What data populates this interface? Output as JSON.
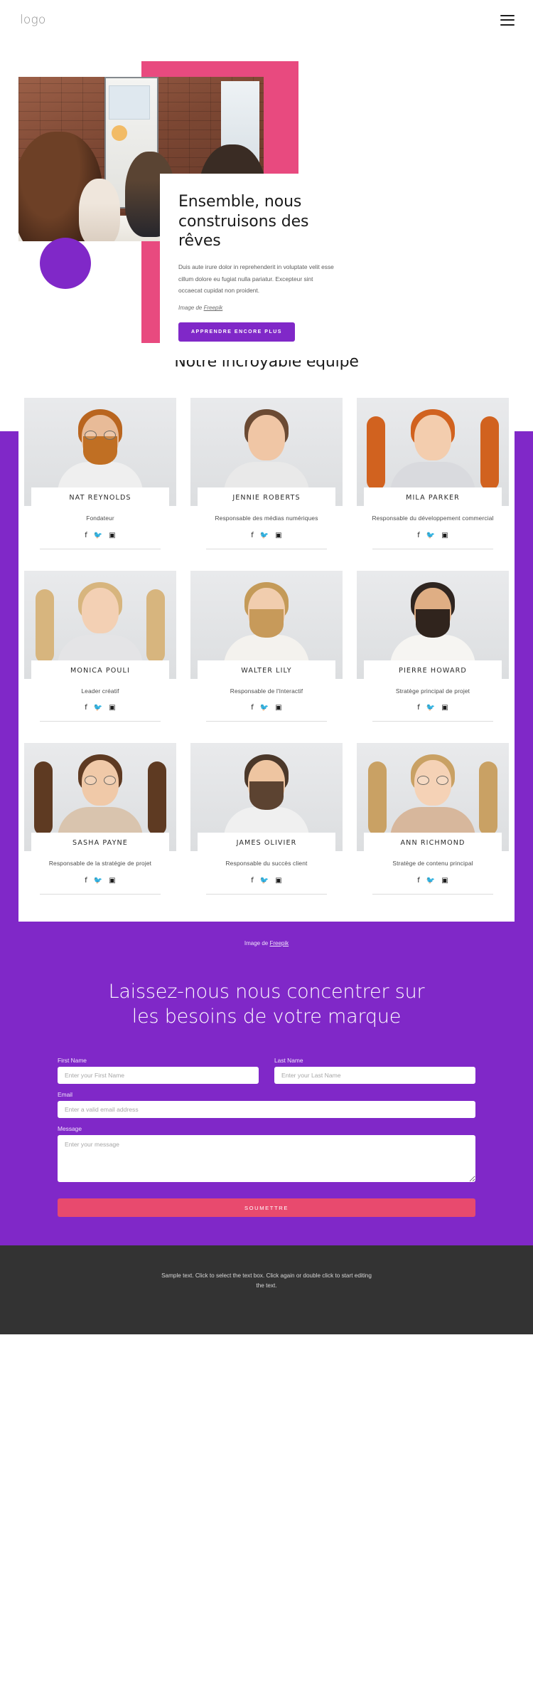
{
  "header": {
    "logo": "logo",
    "menu_icon": "hamburger-menu-icon"
  },
  "hero": {
    "title": "Ensemble, nous construisons des rêves",
    "description": "Duis aute irure dolor in reprehenderit in voluptate velit esse cillum dolore eu fugiat nulla pariatur. Excepteur sint occaecat cupidat non proident.",
    "credit_prefix": "Image de ",
    "credit_link": "Freepik",
    "cta_label": "APPRENDRE ENCORE PLUS",
    "colors": {
      "pink": "#e84a7f",
      "purple": "#8028c8"
    }
  },
  "team": {
    "heading": "Notre incroyable équipe",
    "social_icons": [
      "",
      "",
      ""
    ],
    "members": [
      {
        "name": "NAT REYNOLDS",
        "role": "Fondateur"
      },
      {
        "name": "JENNIE ROBERTS",
        "role": "Responsable des médias numériques"
      },
      {
        "name": "MILA PARKER",
        "role": "Responsable du développement commercial"
      },
      {
        "name": "MONICA POULI",
        "role": "Leader créatif"
      },
      {
        "name": "WALTER LILY",
        "role": "Responsable de l'Interactif"
      },
      {
        "name": "PIERRE HOWARD",
        "role": "Stratège principal de projet"
      },
      {
        "name": "SASHA PAYNE",
        "role": "Responsable de la stratégie de projet"
      },
      {
        "name": "JAMES OLIVIER",
        "role": "Responsable du succès client"
      },
      {
        "name": "ANN RICHMOND",
        "role": "Stratège de contenu principal"
      }
    ]
  },
  "contact": {
    "credit_prefix": "Image de ",
    "credit_link": "Freepik",
    "title": "Laissez-nous nous concentrer sur les besoins de votre marque",
    "fields": {
      "first_name_label": "First Name",
      "first_name_placeholder": "Enter your First Name",
      "first_name_value": "",
      "last_name_label": "Last Name",
      "last_name_placeholder": "Enter your Last Name",
      "last_name_value": "",
      "email_label": "Email",
      "email_placeholder": "Enter a valid email address",
      "email_value": "",
      "message_label": "Message",
      "message_placeholder": "Enter your message",
      "message_value": ""
    },
    "submit_label": "SOUMETTRE",
    "colors": {
      "background": "#8028c8",
      "submit": "#e84a6e"
    }
  },
  "footer": {
    "text": "Sample text. Click to select the text box. Click again or double click to start editing the text.",
    "background": "#333333"
  }
}
